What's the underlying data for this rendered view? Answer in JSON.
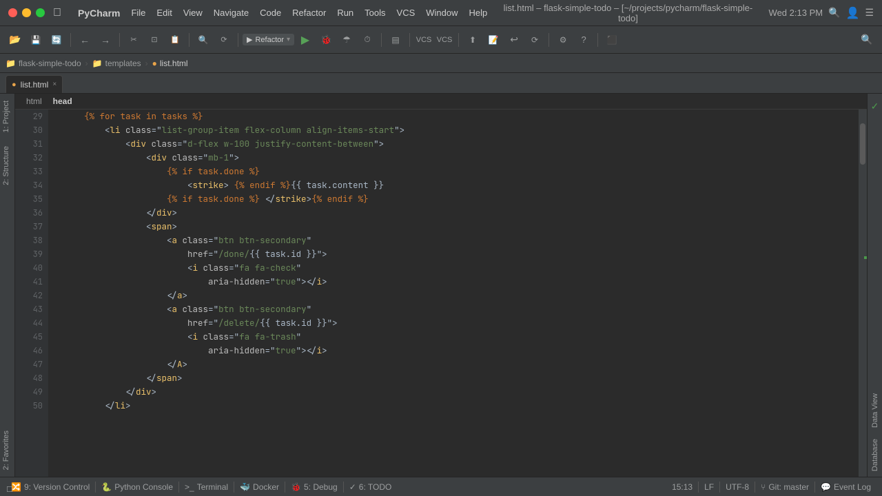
{
  "titlebar": {
    "app_name": "PyCharm",
    "menus": [
      "File",
      "Edit",
      "View",
      "Navigate",
      "Code",
      "Refactor",
      "Run",
      "Tools",
      "VCS",
      "Window",
      "Help"
    ],
    "title": "list.html – flask-simple-todo – [~/projects/pycharm/flask-simple-todo]",
    "datetime": "Wed 2:13 PM"
  },
  "breadcrumb": {
    "items": [
      "flask-simple-todo",
      "templates",
      "list.html"
    ]
  },
  "tab": {
    "label": "list.html",
    "close": "×"
  },
  "code_tabs": {
    "html": "html",
    "head": "head"
  },
  "lines": [
    {
      "num": "29",
      "dot": "·",
      "code": "    {% for task in tasks %}",
      "type": "tmpl"
    },
    {
      "num": "30",
      "dot": "·",
      "code": "        <li class=\"list-group-item flex-column align-items-start\">",
      "type": "tag"
    },
    {
      "num": "31",
      "dot": "·",
      "code": "            <div class=\"d-flex w-100 justify-content-between\">",
      "type": "tag"
    },
    {
      "num": "32",
      "dot": "·",
      "code": "                <div class=\"mb-1\">",
      "type": "tag"
    },
    {
      "num": "33",
      "dot": "·",
      "code": "                    {% if task.done %}",
      "type": "tmpl"
    },
    {
      "num": "34",
      "dot": "·",
      "code": "                        <strike> {% endif %}{{ task.content }}",
      "type": "mixed"
    },
    {
      "num": "35",
      "dot": "·",
      "code": "                    {% if task.done %} </strike>{% endif %}",
      "type": "mixed"
    },
    {
      "num": "36",
      "dot": "·",
      "code": "                </div>",
      "type": "tag"
    },
    {
      "num": "37",
      "dot": "·",
      "code": "                <span>",
      "type": "tag"
    },
    {
      "num": "38",
      "dot": "·",
      "code": "                    <a class=\"btn btn-secondary\"",
      "type": "tag"
    },
    {
      "num": "39",
      "dot": "·",
      "code": "                        href=\"/done/{{ task.id }}\">",
      "type": "mixed"
    },
    {
      "num": "40",
      "dot": "·",
      "code": "                        <i class=\"fa fa-check\"",
      "type": "tag"
    },
    {
      "num": "41",
      "dot": "·",
      "code": "                            aria-hidden=\"true\"></i>",
      "type": "tag"
    },
    {
      "num": "42",
      "dot": "·",
      "code": "                    </a>",
      "type": "tag"
    },
    {
      "num": "43",
      "dot": "·",
      "code": "                    <a class=\"btn btn-secondary\"",
      "type": "tag"
    },
    {
      "num": "44",
      "dot": "·",
      "code": "                        href=\"/delete/{{ task.id }}\">",
      "type": "mixed"
    },
    {
      "num": "45",
      "dot": "·",
      "code": "                        <i class=\"fa fa-trash\"",
      "type": "tag"
    },
    {
      "num": "46",
      "dot": "·",
      "code": "                            aria-hidden=\"true\"></i>",
      "type": "tag"
    },
    {
      "num": "47",
      "dot": "·",
      "code": "                    </A>",
      "type": "tag"
    },
    {
      "num": "48",
      "dot": "·",
      "code": "                </span>",
      "type": "tag"
    },
    {
      "num": "49",
      "dot": "·",
      "code": "            </div>",
      "type": "tag"
    },
    {
      "num": "50",
      "dot": "·",
      "code": "        </li>",
      "type": "tag"
    }
  ],
  "statusbar": {
    "version_control": "9: Version Control",
    "python_console": "Python Console",
    "terminal": "Terminal",
    "docker": "Docker",
    "debug": "5: Debug",
    "todo": "6: TODO",
    "event_log": "Event Log",
    "position": "15:13",
    "line_sep": "LF",
    "encoding": "UTF-8",
    "git": "Git: master"
  },
  "right_tabs": {
    "project": "Project",
    "structure": "Structure",
    "favorites": "2: Favorites",
    "data_view": "Data View",
    "database": "Database"
  },
  "icons": {
    "folder": "📁",
    "file_html": "🟠",
    "vcs_green": "✓",
    "search": "🔍",
    "gear": "⚙",
    "run": "▶",
    "stop": "■",
    "debug": "🐞",
    "build": "🔨",
    "undo": "↩",
    "redo": "↪"
  }
}
